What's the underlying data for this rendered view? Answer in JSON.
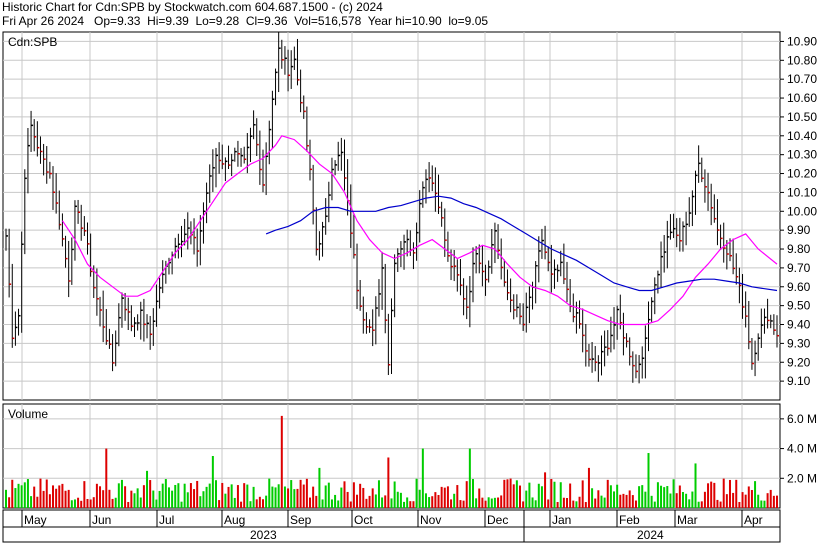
{
  "header": {
    "line1": "Historic Chart for Cdn:SPB by Stockwatch.com 604.687.1500 - (c) 2024",
    "line2": "Fri Apr 26 2024   Op=9.33  Hi=9.39  Lo=9.28  Cl=9.36  Vol=516,578  Year hi=10.90  lo=9.05"
  },
  "colors": {
    "up": "#000000",
    "down": "#cc0000",
    "ma_fast": "#ff00ff",
    "ma_slow": "#0000cc",
    "vol_up": "#00cc00",
    "vol_down": "#dd0000",
    "grid": "#c8c8c8"
  },
  "chart_data": [
    {
      "type": "ohlc",
      "title": "Cdn:SPB",
      "ylim": [
        9.0,
        10.95
      ],
      "y_ticks": [
        "10.90",
        "10.80",
        "10.70",
        "10.60",
        "10.50",
        "10.40",
        "10.30",
        "10.20",
        "10.10",
        "10.00",
        "9.90",
        "9.80",
        "9.70",
        "9.60",
        "9.50",
        "9.40",
        "9.30",
        "9.20",
        "9.10"
      ],
      "months": [
        "May",
        "Jun",
        "Jul",
        "Aug",
        "Sep",
        "Oct",
        "Nov",
        "Dec",
        "Jan",
        "Feb",
        "Mar",
        "Apr"
      ],
      "years": [
        "2023",
        "2024"
      ],
      "grid": true,
      "anchors": [
        [
          0,
          9.87
        ],
        [
          2,
          9.35
        ],
        [
          4,
          9.45
        ],
        [
          6,
          10.2
        ],
        [
          8,
          10.45
        ],
        [
          11,
          10.3
        ],
        [
          14,
          10.2
        ],
        [
          17,
          9.95
        ],
        [
          20,
          9.65
        ],
        [
          22,
          10.0
        ],
        [
          25,
          9.9
        ],
        [
          28,
          9.6
        ],
        [
          31,
          9.4
        ],
        [
          34,
          9.2
        ],
        [
          37,
          9.55
        ],
        [
          40,
          9.4
        ],
        [
          43,
          9.45
        ],
        [
          46,
          9.35
        ],
        [
          49,
          9.6
        ],
        [
          52,
          9.75
        ],
        [
          55,
          9.85
        ],
        [
          58,
          9.9
        ],
        [
          61,
          9.8
        ],
        [
          64,
          10.1
        ],
        [
          67,
          10.3
        ],
        [
          70,
          10.25
        ],
        [
          73,
          10.3
        ],
        [
          76,
          10.25
        ],
        [
          79,
          10.45
        ],
        [
          82,
          10.15
        ],
        [
          85,
          10.6
        ],
        [
          87,
          10.85
        ],
        [
          90,
          10.75
        ],
        [
          92,
          10.8
        ],
        [
          95,
          10.5
        ],
        [
          97,
          10.2
        ],
        [
          99,
          9.8
        ],
        [
          102,
          9.95
        ],
        [
          104,
          10.25
        ],
        [
          107,
          10.3
        ],
        [
          110,
          9.9
        ],
        [
          112,
          9.6
        ],
        [
          114,
          9.45
        ],
        [
          117,
          9.35
        ],
        [
          120,
          9.7
        ],
        [
          122,
          9.2
        ],
        [
          124,
          9.75
        ],
        [
          127,
          9.85
        ],
        [
          130,
          9.8
        ],
        [
          133,
          10.15
        ],
        [
          135,
          10.2
        ],
        [
          138,
          10.05
        ],
        [
          141,
          9.75
        ],
        [
          144,
          9.65
        ],
        [
          147,
          9.5
        ],
        [
          150,
          9.8
        ],
        [
          153,
          9.65
        ],
        [
          156,
          9.9
        ],
        [
          159,
          9.6
        ],
        [
          162,
          9.5
        ],
        [
          165,
          9.4
        ],
        [
          168,
          9.6
        ],
        [
          171,
          9.85
        ],
        [
          174,
          9.65
        ],
        [
          177,
          9.7
        ],
        [
          180,
          9.5
        ],
        [
          183,
          9.4
        ],
        [
          186,
          9.2
        ],
        [
          189,
          9.2
        ],
        [
          192,
          9.3
        ],
        [
          195,
          9.45
        ],
        [
          198,
          9.3
        ],
        [
          201,
          9.15
        ],
        [
          204,
          9.3
        ],
        [
          206,
          9.55
        ],
        [
          209,
          9.75
        ],
        [
          212,
          9.9
        ],
        [
          215,
          9.85
        ],
        [
          218,
          10.0
        ],
        [
          221,
          10.25
        ],
        [
          224,
          10.1
        ],
        [
          227,
          9.9
        ],
        [
          230,
          9.8
        ],
        [
          233,
          9.65
        ],
        [
          236,
          9.45
        ],
        [
          238,
          9.2
        ],
        [
          240,
          9.35
        ],
        [
          243,
          9.45
        ],
        [
          246,
          9.35
        ]
      ],
      "sma_fast": {
        "knots": [
          [
            18,
            9.95
          ],
          [
            22,
            9.85
          ],
          [
            26,
            9.72
          ],
          [
            30,
            9.65
          ],
          [
            34,
            9.6
          ],
          [
            38,
            9.55
          ],
          [
            42,
            9.55
          ],
          [
            46,
            9.58
          ],
          [
            50,
            9.68
          ],
          [
            54,
            9.78
          ],
          [
            58,
            9.85
          ],
          [
            62,
            9.95
          ],
          [
            66,
            10.05
          ],
          [
            70,
            10.15
          ],
          [
            74,
            10.2
          ],
          [
            78,
            10.25
          ],
          [
            82,
            10.28
          ],
          [
            86,
            10.35
          ],
          [
            88,
            10.4
          ],
          [
            92,
            10.38
          ],
          [
            96,
            10.32
          ],
          [
            100,
            10.25
          ],
          [
            104,
            10.2
          ],
          [
            108,
            10.1
          ],
          [
            112,
            9.95
          ],
          [
            116,
            9.85
          ],
          [
            120,
            9.78
          ],
          [
            124,
            9.75
          ],
          [
            128,
            9.78
          ],
          [
            132,
            9.82
          ],
          [
            136,
            9.85
          ],
          [
            140,
            9.8
          ],
          [
            144,
            9.75
          ],
          [
            148,
            9.78
          ],
          [
            152,
            9.82
          ],
          [
            156,
            9.8
          ],
          [
            160,
            9.72
          ],
          [
            164,
            9.65
          ],
          [
            168,
            9.6
          ],
          [
            172,
            9.58
          ],
          [
            176,
            9.55
          ],
          [
            180,
            9.5
          ],
          [
            184,
            9.48
          ],
          [
            188,
            9.45
          ],
          [
            192,
            9.42
          ],
          [
            196,
            9.4
          ],
          [
            200,
            9.4
          ],
          [
            204,
            9.4
          ],
          [
            208,
            9.42
          ],
          [
            212,
            9.48
          ],
          [
            216,
            9.55
          ],
          [
            220,
            9.65
          ],
          [
            224,
            9.72
          ],
          [
            228,
            9.8
          ],
          [
            232,
            9.85
          ],
          [
            236,
            9.88
          ],
          [
            240,
            9.8
          ],
          [
            246,
            9.72
          ]
        ]
      },
      "sma_slow": {
        "knots": [
          [
            83,
            9.88
          ],
          [
            86,
            9.9
          ],
          [
            90,
            9.92
          ],
          [
            94,
            9.95
          ],
          [
            98,
            10.0
          ],
          [
            102,
            10.02
          ],
          [
            106,
            10.02
          ],
          [
            110,
            10.0
          ],
          [
            114,
            10.0
          ],
          [
            118,
            10.0
          ],
          [
            122,
            10.02
          ],
          [
            126,
            10.03
          ],
          [
            130,
            10.05
          ],
          [
            134,
            10.07
          ],
          [
            138,
            10.08
          ],
          [
            142,
            10.07
          ],
          [
            146,
            10.04
          ],
          [
            150,
            10.02
          ],
          [
            154,
            9.99
          ],
          [
            158,
            9.96
          ],
          [
            162,
            9.92
          ],
          [
            166,
            9.88
          ],
          [
            170,
            9.84
          ],
          [
            174,
            9.8
          ],
          [
            178,
            9.77
          ],
          [
            182,
            9.74
          ],
          [
            186,
            9.7
          ],
          [
            190,
            9.66
          ],
          [
            194,
            9.62
          ],
          [
            198,
            9.6
          ],
          [
            202,
            9.58
          ],
          [
            206,
            9.58
          ],
          [
            210,
            9.6
          ],
          [
            214,
            9.62
          ],
          [
            218,
            9.63
          ],
          [
            222,
            9.64
          ],
          [
            226,
            9.64
          ],
          [
            230,
            9.63
          ],
          [
            234,
            9.62
          ],
          [
            238,
            9.6
          ],
          [
            242,
            9.59
          ],
          [
            246,
            9.58
          ]
        ]
      }
    },
    {
      "type": "bar",
      "title": "Volume",
      "y_ticks": [
        "6.0 M",
        "4.0 M",
        "2.0 M"
      ],
      "ylim": [
        0,
        7.0
      ],
      "spikes": [
        [
          32,
          4.0
        ],
        [
          45,
          2.5
        ],
        [
          66,
          3.5
        ],
        [
          88,
          6.2
        ],
        [
          100,
          2.7
        ],
        [
          122,
          3.4
        ],
        [
          133,
          4.0
        ],
        [
          148,
          4.0
        ],
        [
          172,
          2.4
        ],
        [
          186,
          2.7
        ],
        [
          205,
          3.7
        ],
        [
          220,
          3.0
        ]
      ]
    }
  ]
}
